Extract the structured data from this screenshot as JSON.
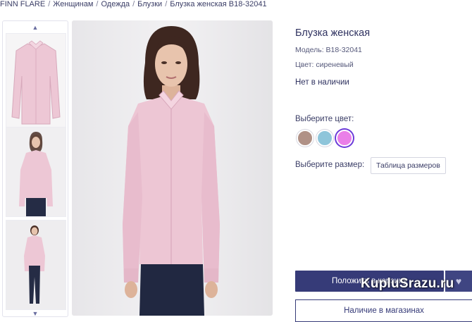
{
  "breadcrumb": [
    "FINN FLARE",
    "Женщинам",
    "Одежда",
    "Блузки",
    "Блузка женская B18-32041"
  ],
  "breadcrumb_separator": "/",
  "gallery": {
    "up_arrow": "▲",
    "down_arrow": "▼",
    "thumbnails": [
      "blouse-front",
      "model-front",
      "model-full"
    ]
  },
  "product": {
    "title": "Блузка женская",
    "model": "Модель: B18-32041",
    "color": "Цвет: сиреневый",
    "stock": "Нет в наличии",
    "choose_color_label": "Выберите цвет:",
    "swatches": [
      {
        "name": "brown",
        "hex": "#b09186",
        "selected": false
      },
      {
        "name": "blue",
        "hex": "#8ec5da",
        "selected": false
      },
      {
        "name": "lilac",
        "hex": "#ea7fe8",
        "selected": true
      }
    ],
    "choose_size_label": "Выберите размер:",
    "size_table_label": "Таблица размеров",
    "add_to_cart_label": "Положить в корзину",
    "favorite_icon": "♥",
    "stores_label": "Наличие в магазинах"
  },
  "watermark": "KupluSrazu.ru",
  "colors": {
    "accent": "#363b78",
    "text": "#2f3260",
    "blouse": "#edc6d4"
  }
}
